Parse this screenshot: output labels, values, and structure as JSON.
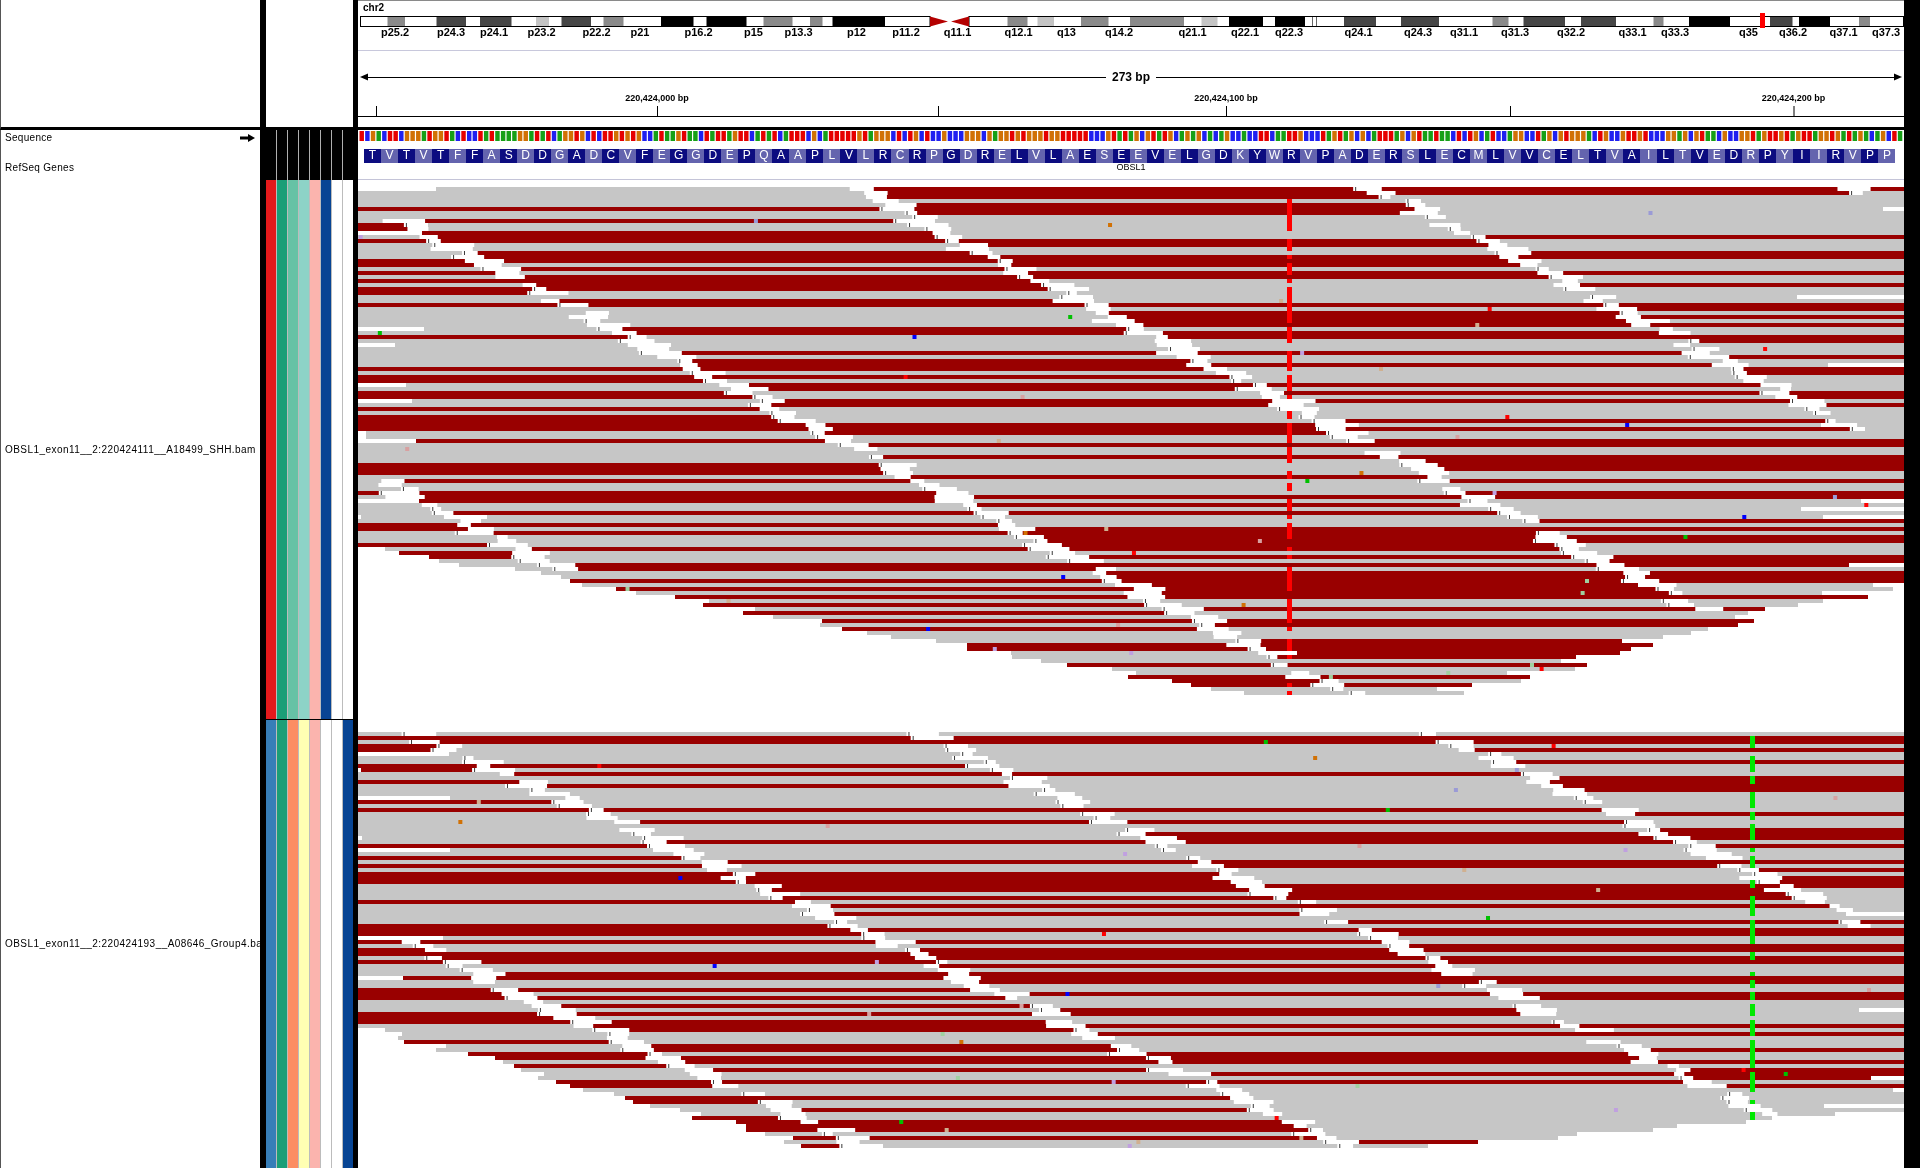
{
  "ideogram": {
    "chromosome": "chr2",
    "band_labels": [
      "p25.2",
      "p24.3",
      "p24.1",
      "p23.2",
      "p22.2",
      "p21",
      "p16.2",
      "p15",
      "p13.3",
      "p12",
      "p11.2",
      "q11.1",
      "q12.1",
      "q13",
      "q14.2",
      "q21.1",
      "q22.1",
      "q22.3",
      "q24.1",
      "q24.3",
      "q31.1",
      "q31.3",
      "q32.2",
      "q33.1",
      "q33.3",
      "q35",
      "q36.2",
      "q37.1",
      "q37.3"
    ]
  },
  "ruler": {
    "span": "273 bp",
    "tick_labels": [
      "220,424,000 bp",
      "220,424,100 bp",
      "220,424,200 bp"
    ]
  },
  "tracks": [
    {
      "kind": "sequence",
      "name": "Sequence"
    },
    {
      "kind": "genes",
      "name": "RefSeq Genes",
      "gene": "OBSL1",
      "amino_acids": [
        "T",
        "V",
        "T",
        "V",
        "T",
        "F",
        "F",
        "A",
        "S",
        "D",
        "D",
        "G",
        "A",
        "D",
        "C",
        "V",
        "F",
        "E",
        "G",
        "G",
        "D",
        "E",
        "P",
        "Q",
        "A",
        "A",
        "P",
        "L",
        "V",
        "L",
        "R",
        "C",
        "R",
        "P",
        "G",
        "D",
        "R",
        "E",
        "L",
        "V",
        "L",
        "A",
        "E",
        "S",
        "E",
        "E",
        "V",
        "E",
        "L",
        "G",
        "D",
        "K",
        "Y",
        "W",
        "R",
        "V",
        "P",
        "A",
        "D",
        "E",
        "R",
        "S",
        "L",
        "E",
        "C",
        "M",
        "L",
        "V",
        "V",
        "C",
        "E",
        "L",
        "T",
        "V",
        "A",
        "I",
        "L",
        "T",
        "V",
        "E",
        "D",
        "R",
        "P",
        "Y",
        "I",
        "I",
        "R",
        "V",
        "P",
        "P"
      ]
    },
    {
      "kind": "alignment",
      "name": "OBSL1_exon11__2:220424111__A18499_SHH.bam",
      "attributes": [
        {
          "color": "#e41a1c"
        },
        {
          "color": "#1b9e77"
        },
        {
          "color": "#66c2a5"
        },
        {
          "color": "#8dd3c7"
        },
        {
          "color": "#fbb4ae"
        },
        {
          "color": "#084594"
        },
        {
          "color": "#ffffff"
        },
        {
          "color": "#ffffff"
        }
      ]
    },
    {
      "kind": "alignment",
      "name": "OBSL1_exon11__2:220424193__A08646_Group4.ba",
      "attributes": [
        {
          "color": "#377eb8"
        },
        {
          "color": "#1b9e77"
        },
        {
          "color": "#fc8d62"
        },
        {
          "color": "#ffffb3"
        },
        {
          "color": "#fbb4ae"
        },
        {
          "color": "#ffffff"
        },
        {
          "color": "#ffffff"
        },
        {
          "color": "#084594"
        }
      ]
    }
  ]
}
